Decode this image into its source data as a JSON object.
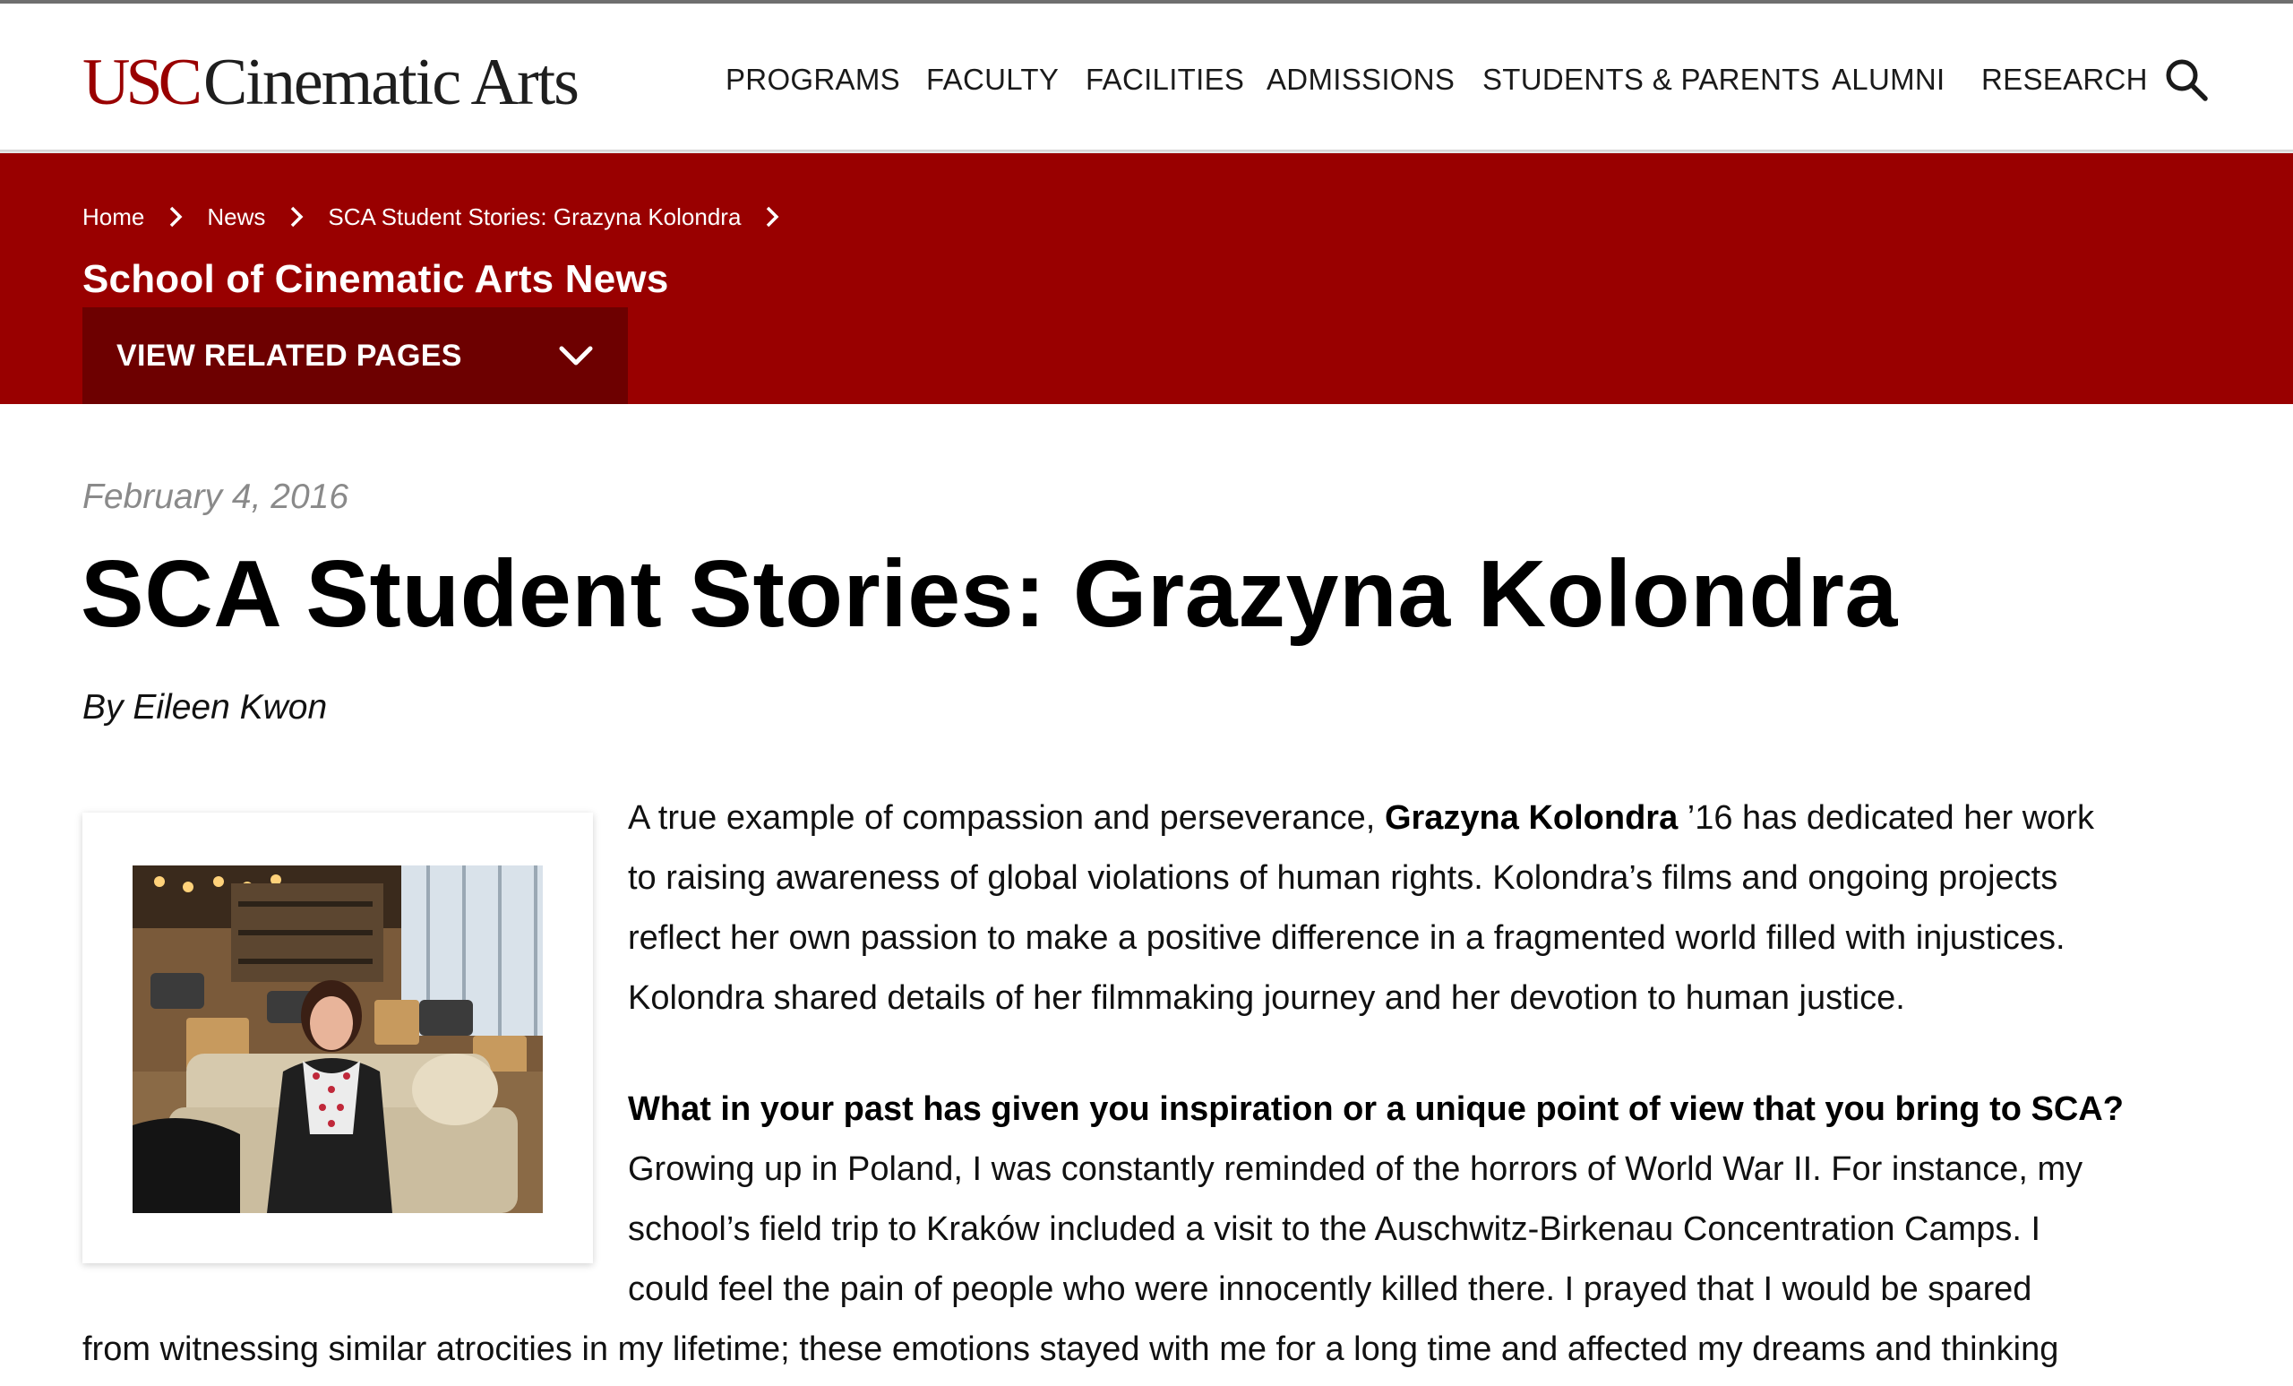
{
  "brand": {
    "logo_usc": "USC",
    "logo_rest": "Cinematic Arts"
  },
  "nav": {
    "items": [
      "PROGRAMS",
      "FACULTY",
      "FACILITIES",
      "ADMISSIONS",
      "STUDENTS & PARENTS",
      "ALUMNI",
      "RESEARCH"
    ],
    "search_icon": "search-icon"
  },
  "breadcrumb": {
    "items": [
      "Home",
      "News",
      "SCA Student Stories: Grazyna Kolondra"
    ]
  },
  "section_title": "School of Cinematic Arts News",
  "related": {
    "label": "VIEW RELATED PAGES",
    "icon": "chevron-down-icon"
  },
  "article": {
    "date": "February 4, 2016",
    "title": "SCA Student Stories: Grazyna Kolondra",
    "byline": "By Eileen Kwon",
    "intro_lines": [
      {
        "pre": "A true example of compassion and perseverance, ",
        "bold": "Grazyna Kolondra",
        "post": " ’16 has dedicated her work"
      },
      {
        "pre": "to raising awareness of global violations of human rights. Kolondra’s films and ongoing projects",
        "bold": "",
        "post": ""
      },
      {
        "pre": "reflect her own passion to make a positive difference in a fragmented world filled with injustices.",
        "bold": "",
        "post": ""
      },
      {
        "pre": "Kolondra shared details of her filmmaking journey and her devotion to human justice.",
        "bold": "",
        "post": ""
      }
    ],
    "question": "What in your past has given you inspiration or a unique point of view that you bring to SCA?",
    "answer_lines": [
      "Growing up in Poland, I was constantly reminded of the horrors of World War II. For instance, my",
      "school’s field trip to Kraków included a visit to the Auschwitz-Birkenau Concentration Camps. I",
      "could feel the pain of people who were innocently killed there. I prayed that I would be spared"
    ],
    "answer_full_line": "from witnessing similar atrocities in my lifetime; these emotions stayed with me for a long time and affected my dreams and thinking"
  },
  "colors": {
    "brand_red": "#990000",
    "dark_red": "#6d0000",
    "date_gray": "#8a8a8a"
  }
}
